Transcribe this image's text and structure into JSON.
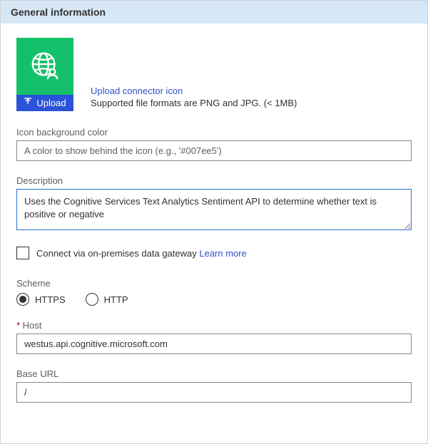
{
  "header": {
    "title": "General information"
  },
  "iconSection": {
    "uploadLabel": "Upload",
    "linkText": "Upload connector icon",
    "supportedText": "Supported file formats are PNG and JPG. (< 1MB)",
    "previewBg": "#14c16a"
  },
  "fields": {
    "iconBgColor": {
      "label": "Icon background color",
      "placeholder": "A color to show behind the icon (e.g., '#007ee5')",
      "value": ""
    },
    "description": {
      "label": "Description",
      "value": "Uses the Cognitive Services Text Analytics Sentiment API to determine whether text is positive or negative"
    },
    "gateway": {
      "label": "Connect via on-premises data gateway",
      "learnMore": "Learn more",
      "checked": false
    },
    "scheme": {
      "label": "Scheme",
      "options": [
        {
          "label": "HTTPS",
          "value": "https",
          "selected": true
        },
        {
          "label": "HTTP",
          "value": "http",
          "selected": false
        }
      ]
    },
    "host": {
      "label": "Host",
      "required": true,
      "value": "westus.api.cognitive.microsoft.com"
    },
    "baseUrl": {
      "label": "Base URL",
      "value": "/"
    }
  }
}
